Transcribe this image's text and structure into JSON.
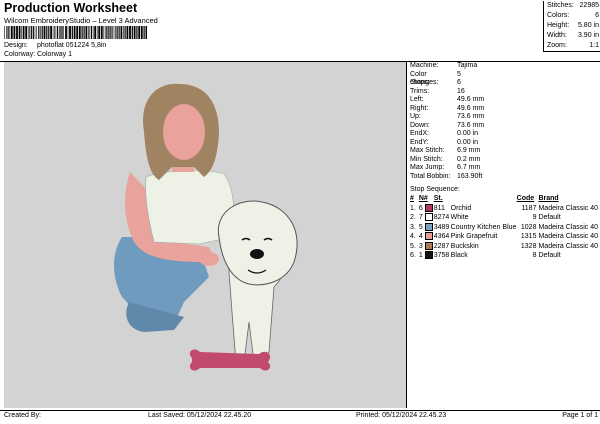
{
  "header": {
    "title": "Production Worksheet",
    "subtitle": "Wilcom EmbroideryStudio – Level 3 Advanced",
    "design_label": "Design:",
    "design_value": "photoflat 051224 5,8in",
    "colorway_label": "Colorway:",
    "colorway_value": "Colorway 1"
  },
  "top_stats": [
    {
      "label": "Stitches:",
      "value": "22985"
    },
    {
      "label": "Colors:",
      "value": "6"
    },
    {
      "label": "Height:",
      "value": "5.80 in"
    },
    {
      "label": "Width:",
      "value": "3.90 in"
    },
    {
      "label": "Zoom:",
      "value": "1:1"
    }
  ],
  "machine_info": [
    {
      "label": "Machine:",
      "value": "Tajima"
    },
    {
      "label": "Color changes:",
      "value": "5"
    },
    {
      "label": "Stops:",
      "value": "6"
    },
    {
      "label": "Trims:",
      "value": "16"
    },
    {
      "label": "Left:",
      "value": "49.6 mm"
    },
    {
      "label": "Right:",
      "value": "49.6 mm"
    },
    {
      "label": "Up:",
      "value": "73.6 mm"
    },
    {
      "label": "Down:",
      "value": "73.6 mm"
    },
    {
      "label": "EndX:",
      "value": "0.00 in"
    },
    {
      "label": "EndY:",
      "value": "0.00 in"
    },
    {
      "label": "Max Stitch:",
      "value": "6.9 mm"
    },
    {
      "label": "Min Stitch:",
      "value": "0.2 mm"
    },
    {
      "label": "Max Jump:",
      "value": "6.7 mm"
    },
    {
      "label": "Total Bobbin:",
      "value": "163.90ft"
    }
  ],
  "stop_sequence": {
    "title": "Stop Sequence:",
    "headers": [
      "#",
      "N#",
      "St.",
      "Code",
      "Brand"
    ],
    "rows": [
      {
        "num": "1.",
        "n": "6",
        "color": "#b03a55",
        "st": "811",
        "name": "Orchid",
        "code": "1187",
        "brand": "Madeira Classic 40"
      },
      {
        "num": "2.",
        "n": "7",
        "color": "#ffffff",
        "st": "8274",
        "name": "White",
        "code": "9",
        "brand": "Default"
      },
      {
        "num": "3.",
        "n": "5",
        "color": "#7aa0c4",
        "st": "3489",
        "name": "Country Kitchen Blue",
        "code": "1028",
        "brand": "Madeira Classic 40"
      },
      {
        "num": "4.",
        "n": "4",
        "color": "#e89a94",
        "st": "4364",
        "name": "Pink Grapefruit",
        "code": "1315",
        "brand": "Madeira Classic 40"
      },
      {
        "num": "5.",
        "n": "3",
        "color": "#a67b5b",
        "st": "2287",
        "name": "Buckskin",
        "code": "1328",
        "brand": "Madeira Classic 40"
      },
      {
        "num": "6.",
        "n": "1",
        "color": "#111111",
        "st": "3758",
        "name": "Black",
        "code": "8",
        "brand": "Default"
      }
    ]
  },
  "footer": {
    "created_by": "Created By:",
    "last_saved": "Last Saved: 05/12/2024 22.45.20",
    "printed": "Printed: 05/12/2024 22.45.23",
    "page": "Page 1 of 1"
  }
}
